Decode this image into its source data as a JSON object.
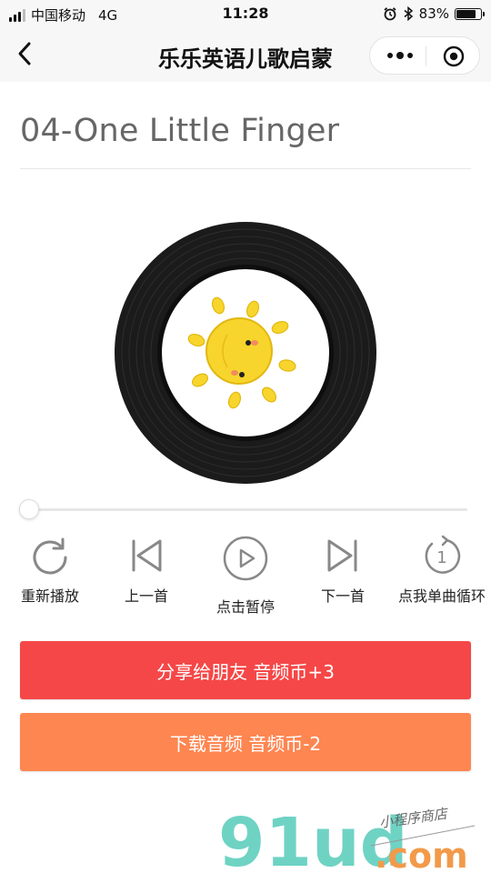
{
  "status_bar": {
    "carrier": "中国移动",
    "network": "4G",
    "time": "11:28",
    "battery_percent": "83%",
    "battery_level": 0.83
  },
  "navbar": {
    "title": "乐乐英语儿歌启蒙",
    "back_icon": "chevron-left-icon",
    "more_icon": "more-dots-icon",
    "close_icon": "target-circle-icon"
  },
  "player": {
    "song_title": "04-One Little Finger",
    "progress": 0,
    "controls": [
      {
        "label": "重新播放",
        "icon": "replay-icon"
      },
      {
        "label": "上一首",
        "icon": "previous-track-icon"
      },
      {
        "label": "点击暂停",
        "icon": "play-icon"
      },
      {
        "label": "下一首",
        "icon": "next-track-icon"
      },
      {
        "label": "点我单曲循环",
        "icon": "repeat-one-icon"
      }
    ]
  },
  "actions": {
    "share_label": "分享给朋友 音频币+3",
    "download_label": "下载音频 音频币-2"
  },
  "watermark": {
    "brand": "91ud",
    "domain": ".com",
    "tagline": "小程序商店"
  },
  "colors": {
    "share_button": "#f54747",
    "download_button": "#fe8651",
    "icon_gray": "#888888"
  }
}
